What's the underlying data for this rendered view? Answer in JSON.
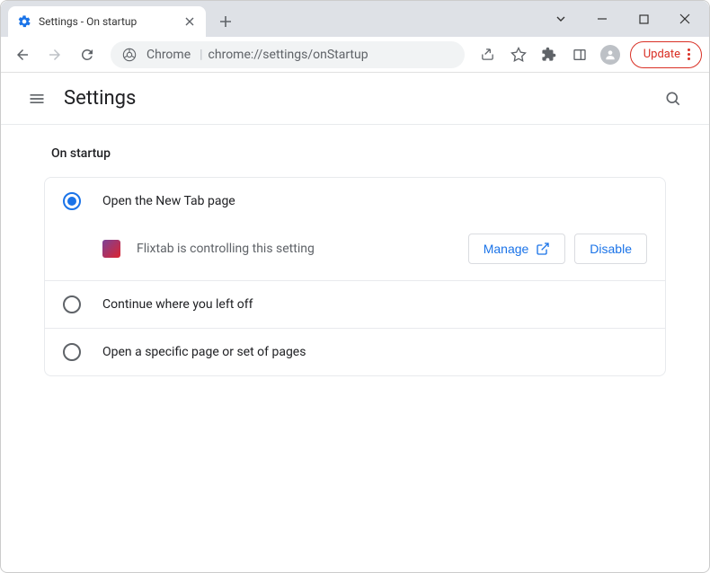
{
  "tab": {
    "title": "Settings - On startup"
  },
  "omnibox": {
    "app_label": "Chrome",
    "url": "chrome://settings/onStartup"
  },
  "toolbar": {
    "update_label": "Update"
  },
  "settings": {
    "title": "Settings"
  },
  "startup": {
    "section_title": "On startup",
    "options": [
      {
        "label": "Open the New Tab page"
      },
      {
        "label": "Continue where you left off"
      },
      {
        "label": "Open a specific page or set of pages"
      }
    ],
    "extension_notice": "Flixtab is controlling this setting",
    "manage_label": "Manage",
    "disable_label": "Disable"
  }
}
